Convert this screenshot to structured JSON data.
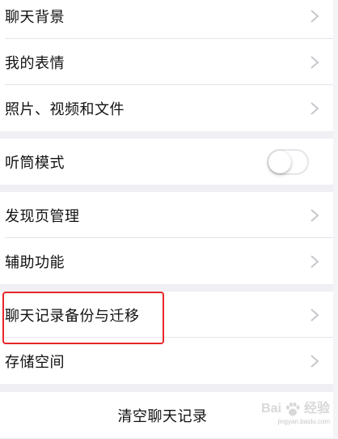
{
  "settings": {
    "group1": [
      {
        "label": "聊天背景"
      },
      {
        "label": "我的表情"
      },
      {
        "label": "照片、视频和文件"
      }
    ],
    "group2": [
      {
        "label": "听筒模式",
        "toggle": false
      }
    ],
    "group3": [
      {
        "label": "发现页管理"
      },
      {
        "label": "辅助功能"
      }
    ],
    "group4": [
      {
        "label": "聊天记录备份与迁移",
        "highlighted": true
      },
      {
        "label": "存储空间"
      }
    ],
    "clear_history_label": "清空聊天记录"
  },
  "watermark": {
    "brand": "Bai",
    "brand_cn": "经验",
    "url": "jingyan.baidu.com"
  },
  "colors": {
    "background": "#efeff4",
    "highlight_border": "#e8262a",
    "chevron": "#c7c7cc"
  },
  "icons": {
    "chevron": "chevron-right-icon",
    "paw": "baidu-paw-icon"
  }
}
